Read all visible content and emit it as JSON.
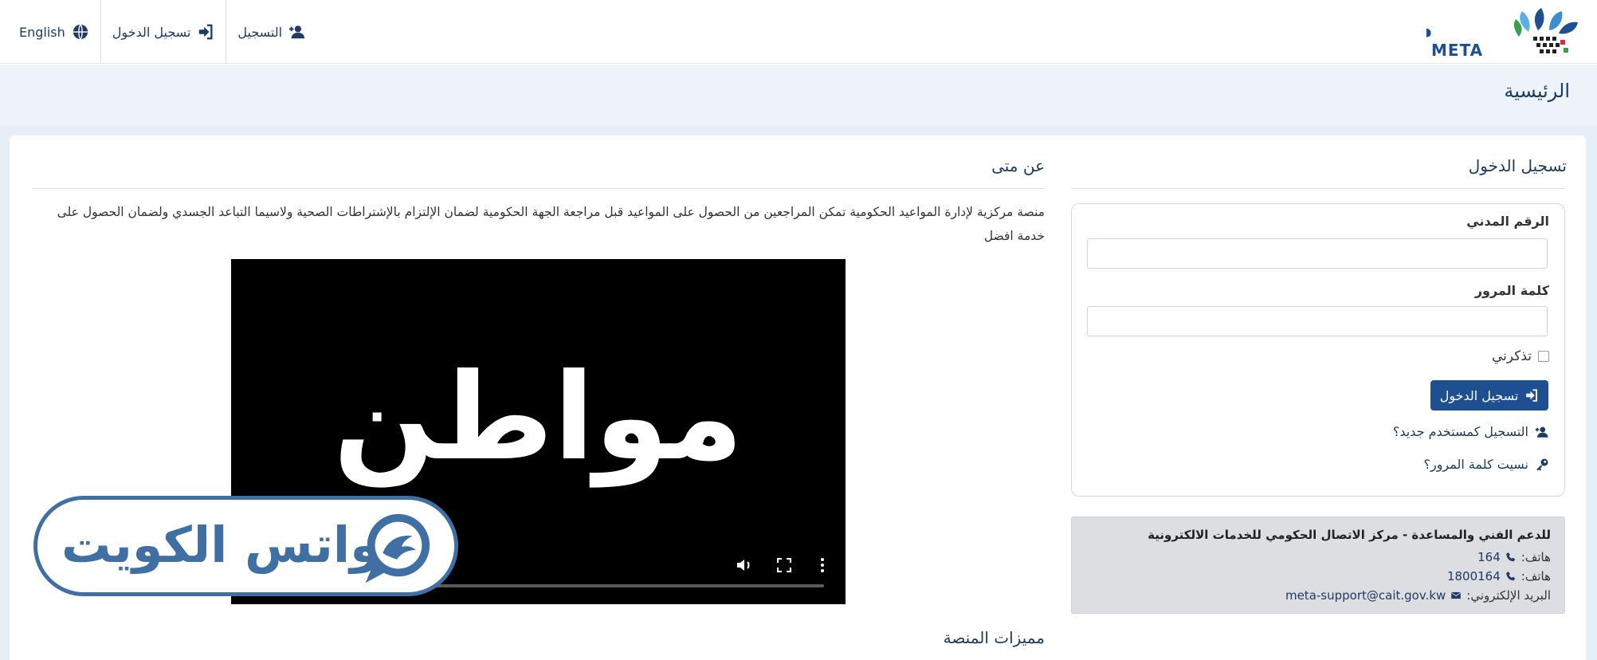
{
  "nav": {
    "english": "English",
    "login": "تسجيل الدخول",
    "register": "التسجيل"
  },
  "logo": {
    "arabic": "متى",
    "latin": "META",
    "colors": [
      "#1d4f91",
      "#3b8fd1",
      "#5bb1e5",
      "#d3313a",
      "#3a9e4a"
    ]
  },
  "breadcrumb": {
    "title": "الرئيسية"
  },
  "login": {
    "section_title": "تسجيل الدخول",
    "civil_id_label": "الرقم المدني",
    "civil_id_value": "",
    "password_label": "كلمة المرور",
    "password_value": "",
    "remember_label": "تذكرني",
    "submit_label": "تسجيل الدخول",
    "register_link": "التسجيل كمستخدم جديد؟",
    "forgot_link": "نسيت كلمة المرور؟"
  },
  "support": {
    "title": "للدعم الفني والمساعدة - مركز الاتصال الحكومي للخدمات الالكترونية",
    "phone_label_1": "هاتف:",
    "phone_1": "164",
    "phone_label_2": "هاتف:",
    "phone_2": "1800164",
    "email_label": "البريد الإلكتروني:",
    "email": "meta-support@cait.gov.kw"
  },
  "about": {
    "section_title": "عن متى",
    "text": "منصة مركزية لإدارة المواعيد الحكومية تمكن المراجعين من الحصول على المواعيد قبل مراجعة الجهة الحكومية لضمان الإلتزام بالإشتراطات الصحية ولاسيما التباعد الجسدي ولضمان الحصول على خدمة افضل",
    "video_word": "مواطن",
    "features_title": "مميزات المنصة"
  },
  "watermark": {
    "text": "واتس الكويت"
  },
  "colors": {
    "primary": "#1d4f91",
    "text_blue": "#1f3b63",
    "band": "#eef3fa",
    "support_bg": "#dcdee1"
  }
}
